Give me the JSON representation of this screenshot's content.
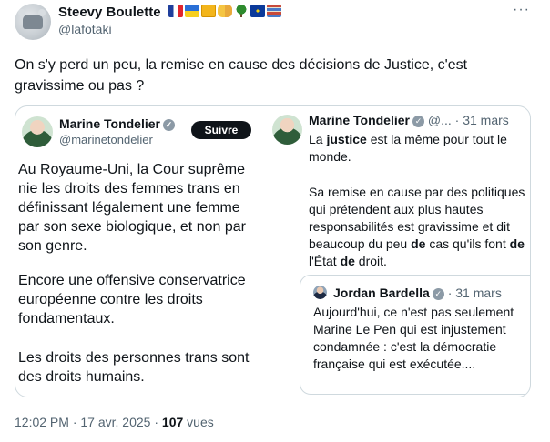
{
  "author": {
    "display_name": "Steevy Boulette",
    "handle": "@lafotaki",
    "flag_icons": [
      "france-flag-icon",
      "ukraine-flag-icon",
      "beer-icon",
      "people-icon",
      "tree-icon",
      "eu-flag-icon",
      "books-icon"
    ]
  },
  "more_icon": "···",
  "tweet_text": "On s'y perd un peu, la remise en cause des décisions de Justice, c'est gravissime ou pas ?",
  "quoted_image": {
    "left": {
      "name": "Marine Tondelier",
      "handle": "@marinetondelier",
      "follow_label": "Suivre",
      "paragraphs": [
        "Au Royaume-Uni, la Cour suprême nie les droits des femmes trans en définissant légalement une femme par son sexe biologique, et non par son genre.",
        "Encore une offensive conservatrice européenne contre les droits fondamentaux.",
        "Les droits des personnes trans sont des droits humains."
      ]
    },
    "right": {
      "name": "Marine Tondelier",
      "meta": "@... · 31 mars",
      "para1_parts": [
        "La ",
        "justice",
        " est la même pour tout le monde."
      ],
      "para2_parts": [
        "Sa remise en cause par des politiques qui prétendent aux plus hautes responsabilités est gravissime et dit beaucoup du peu ",
        "de",
        " cas qu'ils font ",
        "de",
        " l'État ",
        "de",
        " droit."
      ],
      "inner": {
        "name": "Jordan Bardella",
        "meta": "· 31 mars",
        "text": "Aujourd'hui, ce n'est pas seulement Marine Le Pen qui est injustement condamnée : c'est la démocratie française qui est exécutée...."
      }
    }
  },
  "footer": {
    "time": "12:02 PM",
    "separator": " · ",
    "date": "17 avr. 2025",
    "views_count": "107",
    "views_label": "vues"
  }
}
